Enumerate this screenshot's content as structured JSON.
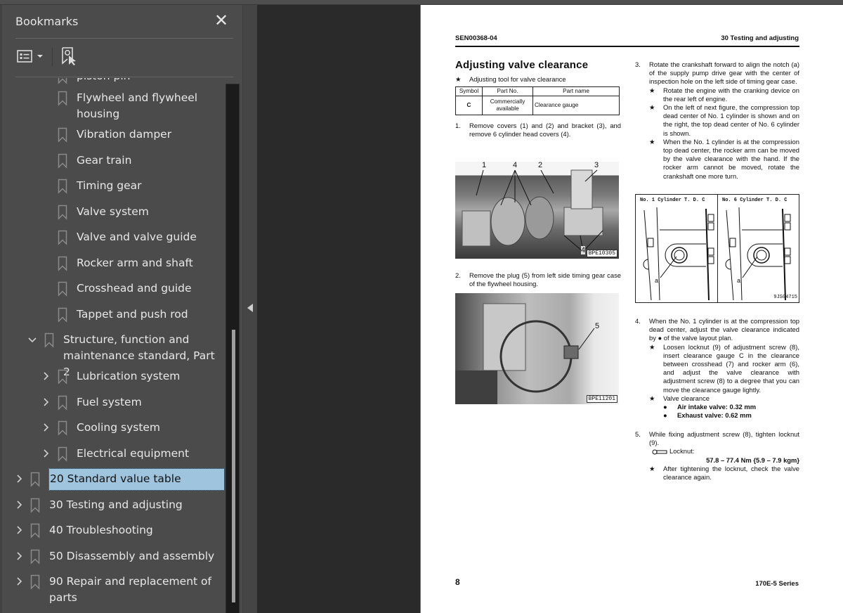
{
  "sidebar": {
    "title": "Bookmarks",
    "close_icon": "close-icon",
    "toolbar": {
      "options_icon": "list-options-icon",
      "options_dropdown_icon": "caret-down-icon",
      "find_bookmark_icon": "bookmark-find-icon"
    },
    "items": [
      {
        "label": "piston pin",
        "level": 2,
        "expandable": false,
        "partial": true
      },
      {
        "label": "Flywheel and flywheel housing",
        "level": 2,
        "expandable": false
      },
      {
        "label": "Vibration damper",
        "level": 2,
        "expandable": false
      },
      {
        "label": "Gear train",
        "level": 2,
        "expandable": false
      },
      {
        "label": "Timing gear",
        "level": 2,
        "expandable": false
      },
      {
        "label": "Valve system",
        "level": 2,
        "expandable": false
      },
      {
        "label": "Valve and valve guide",
        "level": 2,
        "expandable": false
      },
      {
        "label": "Rocker arm and shaft",
        "level": 2,
        "expandable": false
      },
      {
        "label": "Crosshead and guide",
        "level": 2,
        "expandable": false
      },
      {
        "label": "Tappet and push rod",
        "level": 2,
        "expandable": false
      },
      {
        "label": "Structure, function and maintenance standard, Part 2",
        "level": 1,
        "expandable": true,
        "expanded": true
      },
      {
        "label": "Lubrication system",
        "level": 2,
        "expandable": true
      },
      {
        "label": "Fuel system",
        "level": 2,
        "expandable": true
      },
      {
        "label": "Cooling system",
        "level": 2,
        "expandable": true
      },
      {
        "label": "Electrical equipment",
        "level": 2,
        "expandable": true
      },
      {
        "label": "20 Standard value table",
        "level": 0,
        "expandable": true,
        "selected": true
      },
      {
        "label": "30 Testing and adjusting",
        "level": 0,
        "expandable": true
      },
      {
        "label": "40 Troubleshooting",
        "level": 0,
        "expandable": true
      },
      {
        "label": "50 Disassembly and assembly",
        "level": 0,
        "expandable": true
      },
      {
        "label": "90 Repair and replacement of parts",
        "level": 0,
        "expandable": true
      }
    ],
    "selected_color": "#9fc5de"
  },
  "page": {
    "header_left": "SEN00368-04",
    "header_right": "30 Testing and adjusting",
    "title": "Adjusting valve clearance",
    "tool_note": "Adjusting tool for valve clearance",
    "tool_table": {
      "headers": [
        "Symbol",
        "Part No.",
        "Part name"
      ],
      "rows": [
        [
          "C",
          "Commercially available",
          "Clearance gauge"
        ]
      ]
    },
    "steps": [
      {
        "num": "1.",
        "text": "Remove covers (1) and (2) and bracket (3), and remove 6 cylinder head covers (4)."
      },
      {
        "num": "2.",
        "text": "Remove the plug (5) from left side timing gear case of the flywheel housing."
      },
      {
        "num": "3.",
        "text": "Rotate the crankshaft forward to align the notch (a) of the supply pump drive gear with the center of inspection hole on the left side of timing gear case.",
        "notes": [
          "Rotate the engine with the cranking device on the rear left of engine.",
          "On the left of next figure, the compression top dead center of No. 1 cylinder is shown and on the right, the top dead center of No. 6 cylinder is shown.",
          "When the No. 1 cylinder is at the compression top dead center, the rocker arm can be moved by the valve clearance with the hand. If the rocker arm cannot be moved, rotate the crankshaft one more turn."
        ]
      },
      {
        "num": "4.",
        "text": "When the No. 1 cylinder is at the compression top dead center, adjust the valve clearance indicated by ● of the valve layout plan.",
        "notes": [
          "Loosen locknut (9) of adjustment screw (8), insert clearance gauge C in the clearance between crosshead (7) and rocker arm (6), and adjust the valve clearance with adjustment screw (8) to a degree that you can move the clearance gauge lightly.",
          "Valve clearance"
        ],
        "bullets": [
          "Air intake valve: 0.32 mm",
          "Exhaust valve: 0.62 mm"
        ]
      },
      {
        "num": "5.",
        "text": "While fixing adjustment screw (8), tighten locknut (9).",
        "torque_label": "Locknut:",
        "torque_value": "57.8 – 77.4 Nm {5.9 – 7.9 kgm}",
        "notes": [
          "After tightening the locknut, check the valve clearance again."
        ]
      }
    ],
    "figure1": {
      "labels": [
        "1",
        "4",
        "2",
        "3",
        "4"
      ],
      "code": "BPE10305"
    },
    "figure2": {
      "labels": [
        "5"
      ],
      "code": "BPE11201"
    },
    "figure3": {
      "left_title": "No. 1 Cylinder T. D. C",
      "right_title": "No. 6 Cylinder T. D. C",
      "notch_label": "a",
      "code": "9JS04715"
    },
    "footer_page": "8",
    "footer_series": "170E-5 Series",
    "star": "★",
    "dot": "●"
  }
}
